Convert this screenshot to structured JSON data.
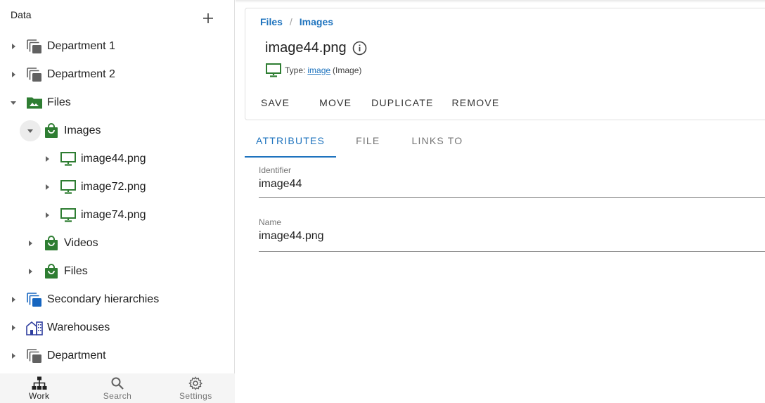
{
  "sidebar": {
    "title": "Data",
    "tree": [
      {
        "label": "Department 1",
        "icon": "collection-gray-icon",
        "level": 0,
        "expanded": false
      },
      {
        "label": "Department 2",
        "icon": "collection-gray-icon",
        "level": 0,
        "expanded": false
      },
      {
        "label": "Files",
        "icon": "image-folder-icon",
        "level": 0,
        "expanded": true
      },
      {
        "label": "Images",
        "icon": "bag-icon",
        "level": 1,
        "expanded": true
      },
      {
        "label": "image44.png",
        "icon": "monitor-icon",
        "level": 2,
        "expanded": false
      },
      {
        "label": "image72.png",
        "icon": "monitor-icon",
        "level": 2,
        "expanded": false
      },
      {
        "label": "image74.png",
        "icon": "monitor-icon",
        "level": 2,
        "expanded": false
      },
      {
        "label": "Videos",
        "icon": "bag-icon",
        "level": 1,
        "expanded": false
      },
      {
        "label": "Files",
        "icon": "bag-icon",
        "level": 1,
        "expanded": false
      },
      {
        "label": "Secondary hierarchies",
        "icon": "collection-blue-icon",
        "level": 0,
        "expanded": false
      },
      {
        "label": "Warehouses",
        "icon": "warehouse-icon",
        "level": 0,
        "expanded": false
      },
      {
        "label": "Department",
        "icon": "collection-gray-icon",
        "level": 0,
        "expanded": false
      }
    ]
  },
  "bottom_nav": {
    "work": "Work",
    "search": "Search",
    "settings": "Settings"
  },
  "breadcrumb": [
    "Files",
    "Images"
  ],
  "breadcrumb_separator": "/",
  "item": {
    "title": "image44.png",
    "type_prefix": "Type:",
    "type_link": "image",
    "type_suffix": "(Image)"
  },
  "actions": {
    "save": "SAVE",
    "move": "MOVE",
    "duplicate": "DUPLICATE",
    "remove": "REMOVE"
  },
  "tabs": {
    "attributes": "ATTRIBUTES",
    "file": "FILE",
    "links_to": "LINKS TO"
  },
  "fields": {
    "identifier_label": "Identifier",
    "identifier_value": "image44",
    "name_label": "Name",
    "name_value": "image44.png"
  },
  "colors": {
    "accent": "#1e73be",
    "green": "#2e7d32",
    "gray_icon": "#616161",
    "blue_icon": "#1565c0"
  }
}
